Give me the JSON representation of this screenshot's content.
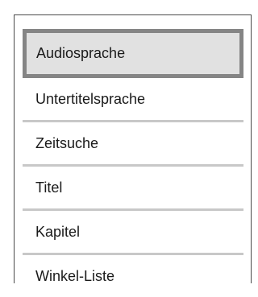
{
  "menu": {
    "items": [
      {
        "label": "Audiosprache",
        "selected": true
      },
      {
        "label": "Untertitelsprache",
        "selected": false
      },
      {
        "label": "Zeitsuche",
        "selected": false
      },
      {
        "label": "Titel",
        "selected": false
      },
      {
        "label": "Kapitel",
        "selected": false
      },
      {
        "label": "Winkel-Liste",
        "selected": false
      }
    ],
    "colors": {
      "selected_background": "#e1e1e1",
      "selected_border": "#858585",
      "divider": "#c8c8c8",
      "frame": "#4a4a4a",
      "text": "#1a1a1a"
    }
  }
}
